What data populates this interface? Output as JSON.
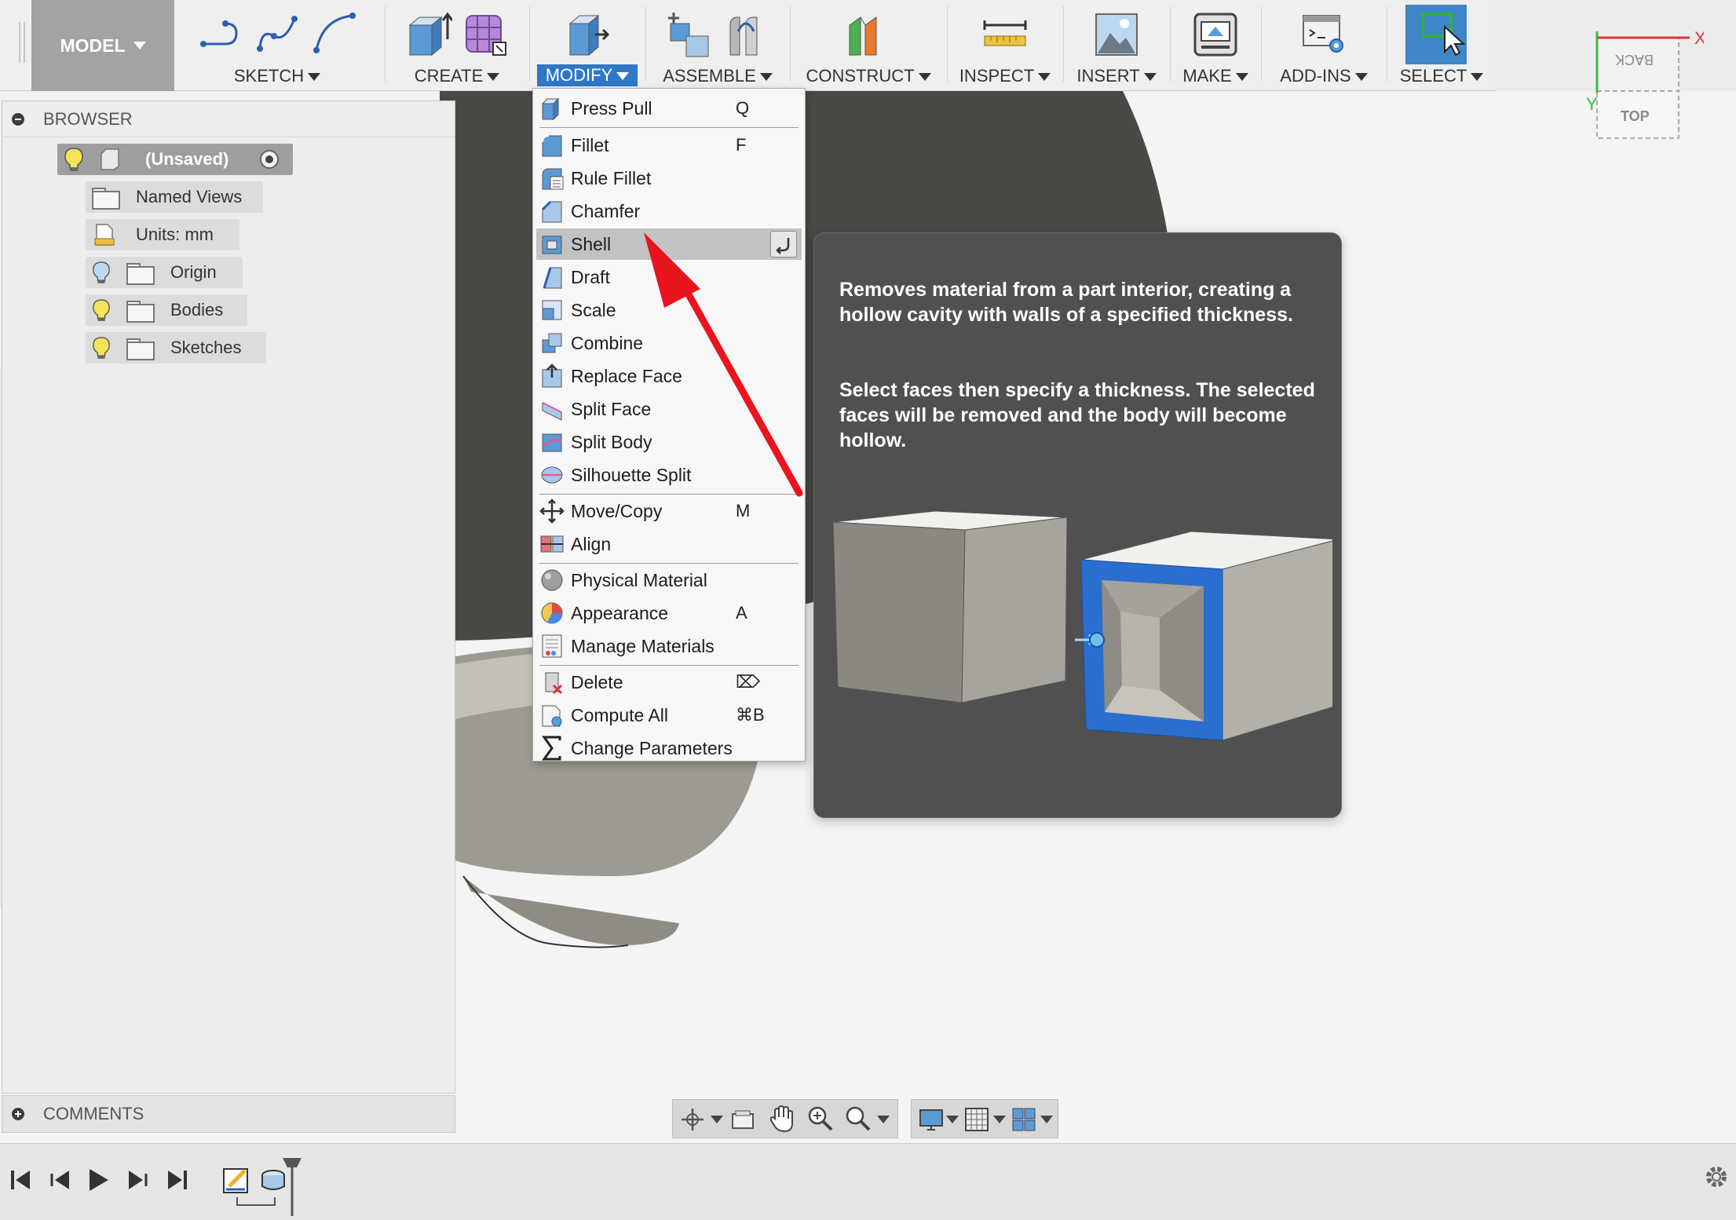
{
  "toolbar": {
    "model": "MODEL",
    "groups": {
      "sketch": "SKETCH",
      "create": "CREATE",
      "modify": "MODIFY",
      "assemble": "ASSEMBLE",
      "construct": "CONSTRUCT",
      "inspect": "INSPECT",
      "insert": "INSERT",
      "make": "MAKE",
      "addins": "ADD-INS",
      "select": "SELECT"
    }
  },
  "viewcube": {
    "face_top": "TOP",
    "face_back": "BACK",
    "axis_x": "X",
    "axis_y": "Y"
  },
  "browser": {
    "title": "BROWSER",
    "items": [
      {
        "label": "(Unsaved)"
      },
      {
        "label": "Named Views"
      },
      {
        "label": "Units: mm"
      },
      {
        "label": "Origin"
      },
      {
        "label": "Bodies"
      },
      {
        "label": "Sketches"
      }
    ]
  },
  "comments": {
    "title": "COMMENTS"
  },
  "modify_menu": {
    "items": [
      {
        "label": "Press Pull",
        "key": "Q",
        "icon": "press-pull-icon"
      },
      {
        "label": "Fillet",
        "key": "F",
        "icon": "fillet-icon"
      },
      {
        "label": "Rule Fillet",
        "key": "",
        "icon": "rule-fillet-icon"
      },
      {
        "label": "Chamfer",
        "key": "",
        "icon": "chamfer-icon"
      },
      {
        "label": "Shell",
        "key": "",
        "icon": "shell-icon"
      },
      {
        "label": "Draft",
        "key": "",
        "icon": "draft-icon"
      },
      {
        "label": "Scale",
        "key": "",
        "icon": "scale-icon"
      },
      {
        "label": "Combine",
        "key": "",
        "icon": "combine-icon"
      },
      {
        "label": "Replace Face",
        "key": "",
        "icon": "replace-face-icon"
      },
      {
        "label": "Split Face",
        "key": "",
        "icon": "split-face-icon"
      },
      {
        "label": "Split Body",
        "key": "",
        "icon": "split-body-icon"
      },
      {
        "label": "Silhouette Split",
        "key": "",
        "icon": "silhouette-split-icon"
      },
      {
        "label": "Move/Copy",
        "key": "M",
        "icon": "move-icon"
      },
      {
        "label": "Align",
        "key": "",
        "icon": "align-icon"
      },
      {
        "label": "Physical Material",
        "key": "",
        "icon": "physical-material-icon"
      },
      {
        "label": "Appearance",
        "key": "A",
        "icon": "appearance-icon"
      },
      {
        "label": "Manage Materials",
        "key": "",
        "icon": "manage-materials-icon"
      },
      {
        "label": "Delete",
        "key": "⌦",
        "icon": "delete-icon"
      },
      {
        "label": "Compute All",
        "key": "⌘B",
        "icon": "compute-all-icon"
      },
      {
        "label": "Change Parameters",
        "key": "",
        "icon": "sigma-icon"
      }
    ]
  },
  "tooltip": {
    "para1": "Removes material from a part interior, creating a hollow cavity with walls of a specified thickness.",
    "para2": "Select faces then specify a thickness. The selected faces will be removed and the body will become hollow."
  },
  "colors": {
    "accent": "#2e78c8",
    "arrow": "#e8141e",
    "shell_rim": "#2a6fd0"
  }
}
